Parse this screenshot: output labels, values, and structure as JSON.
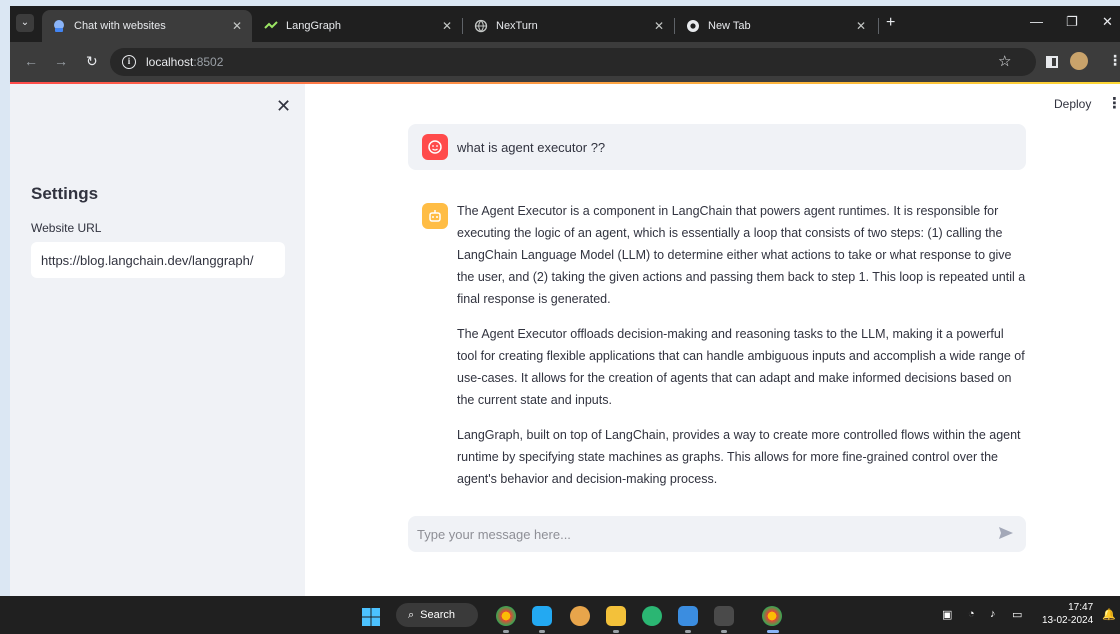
{
  "browser": {
    "tabs": [
      {
        "title": "Chat with websites",
        "active": true
      },
      {
        "title": "LangGraph",
        "active": false
      },
      {
        "title": "NexTurn",
        "active": false
      },
      {
        "title": "New Tab",
        "active": false
      }
    ],
    "url_host": "localhost",
    "url_port": ":8502"
  },
  "sidebar": {
    "title": "Settings",
    "website_url_label": "Website URL",
    "website_url_value": "https://blog.langchain.dev/langgraph/"
  },
  "header": {
    "deploy_label": "Deploy"
  },
  "chat": {
    "user_message": "what is agent executor ??",
    "assistant_paragraphs": [
      "The Agent Executor is a component in LangChain that powers agent runtimes. It is responsible for executing the logic of an agent, which is essentially a loop that consists of two steps: (1) calling the LangChain Language Model (LLM) to determine either what actions to take or what response to give the user, and (2) taking the given actions and passing them back to step 1. This loop is repeated until a final response is generated.",
      "The Agent Executor offloads decision-making and reasoning tasks to the LLM, making it a powerful tool for creating flexible applications that can handle ambiguous inputs and accomplish a wide range of use-cases. It allows for the creation of agents that can adapt and make informed decisions based on the current state and inputs.",
      "LangGraph, built on top of LangChain, provides a way to create more controlled flows within the agent runtime by specifying state machines as graphs. This allows for more fine-grained control over the agent's behavior and decision-making process."
    ],
    "input_placeholder": "Type your message here..."
  },
  "taskbar": {
    "search_label": "Search",
    "time": "17:47",
    "date": "13-02-2024"
  },
  "colors": {
    "accent_red": "#ff4b4b",
    "accent_yellow": "#ffbd45",
    "sidebar_bg": "#f0f2f6",
    "text": "#31333f"
  }
}
